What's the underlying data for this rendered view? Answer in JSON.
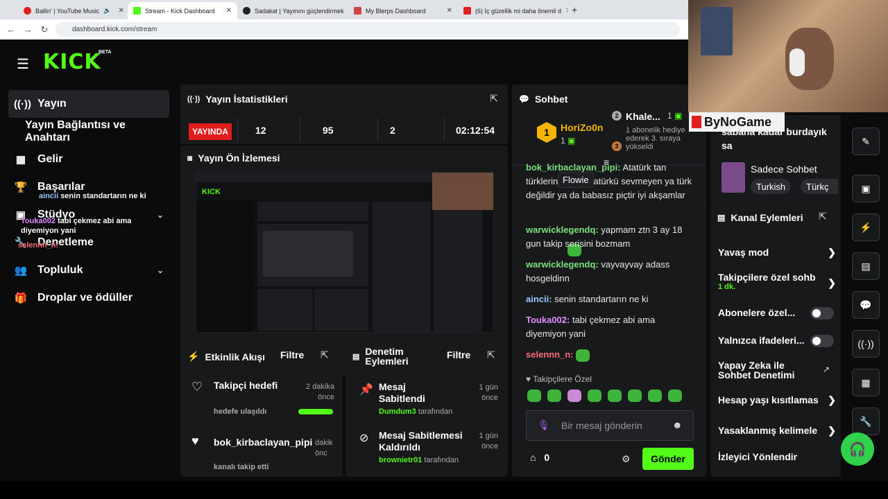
{
  "browser": {
    "tabs": [
      {
        "title": "Ballin' | YouTube Music",
        "color": "#e02020",
        "active": false
      },
      {
        "title": "Stream - Kick Dashboard",
        "color": "#53fc18",
        "active": true
      },
      {
        "title": "Sadakat | Yayınını güçlendirmek",
        "color": "#222",
        "active": false
      },
      {
        "title": "My Blerps Dashboard",
        "color": "#b44",
        "active": false
      },
      {
        "title": "(6) İç güzellik mi daha önemli d",
        "color": "#e02020",
        "active": false
      }
    ],
    "url": "dashboard.kick.com/stream"
  },
  "header": {
    "logo": "KICK",
    "beta": "BETA"
  },
  "sidebar": {
    "items": [
      {
        "label": "Yayın",
        "icon": "broadcast-icon"
      },
      {
        "label": "Yayın Bağlantısı ve Anahtarı",
        "icon": ""
      },
      {
        "label": "Gelir",
        "icon": "chart-icon"
      },
      {
        "label": "Başarılar",
        "icon": "trophy-icon"
      },
      {
        "label": "Stüdyo",
        "icon": "studio-icon"
      },
      {
        "label": "Denetleme",
        "icon": "wrench-icon"
      },
      {
        "label": "Topluluk",
        "icon": "people-icon"
      },
      {
        "label": "Droplar ve ödüller",
        "icon": "drops-icon"
      }
    ],
    "overlay_chat": [
      {
        "user": "aincii",
        "text": "senin standartarın ne ki"
      },
      {
        "user": "Touka002",
        "text": "tabi çekmez abi ama diyemiyon yani"
      },
      {
        "user": "selennn_n:",
        "text": ""
      }
    ]
  },
  "stats": {
    "title": "Yayın İstatistikleri",
    "live_label": "YAYINDA",
    "values": [
      "12",
      "95",
      "2",
      "02:12:54"
    ]
  },
  "preview": {
    "title": "Yayın Ön İzlemesi"
  },
  "activity": {
    "title": "Etkinlik Akışı",
    "filter": "Filtre",
    "items": [
      {
        "title": "Takipçi hedefi",
        "time": "2 dakika önce",
        "sub": "hedefe ulaşıldı"
      },
      {
        "title": "bok_kirbaclayan_pipi",
        "time": "dakik önc",
        "sub": "kanalı takip etti"
      }
    ]
  },
  "moderation": {
    "title": "Denetim Eylemleri",
    "filter": "Filtre",
    "items": [
      {
        "title": "Mesaj Sabitlendi",
        "time": "1 gün önce",
        "user": "Dumdum3",
        "suffix": "tarafından"
      },
      {
        "title": "Mesaj Sabitlemesi Kaldırıldı",
        "time": "1 gün önce",
        "user": "brownietr01",
        "suffix": "tarafından"
      }
    ]
  },
  "chat": {
    "title": "Sohbet",
    "top": [
      {
        "rank": "1",
        "name": "HoriZo0n",
        "count": "1"
      },
      {
        "rank": "2",
        "name": "Khale...",
        "count": "1"
      }
    ],
    "gift_text": "1 abonelik hediye ederek 3. sıraya yükseldi",
    "tooltip": "Flowie",
    "pinned_user": "bok_kirbaclayan_pipi:",
    "pinned_text": "Atatürk tan türklerin ..... ır, Atatürkü sevmeyen ya türk değildir ya da babasız piçtir iyi akşamlar",
    "messages": [
      {
        "user": "warwicklegendq:",
        "color": "#7be07b",
        "text": "yapmam ztn 3 ay 18 gun takip serisini bozmam"
      },
      {
        "user": "warwicklegendq:",
        "color": "#7be07b",
        "text": "vayvayvay adass hosgeldinn"
      },
      {
        "user": "aincii:",
        "color": "#9ac9ff",
        "text": "senin standartarın ne ki"
      },
      {
        "user": "Touka002:",
        "color": "#e28cff",
        "text": "tabi çekmez abi ama diyemiyon yani"
      },
      {
        "user": "selennn_n:",
        "color": "#ff6b7a",
        "text": ""
      }
    ],
    "followers_only": "Takipçilere Özel",
    "input_placeholder": "Bir mesaj gönderin",
    "points": "0",
    "send": "Gönder"
  },
  "channel": {
    "top_text": "sabaha kadar burdayık sa",
    "brand": "ByNoGame",
    "category": "Sadece Sohbet",
    "tags": [
      "Turkish",
      "Türkç"
    ],
    "title": "Kanal Eylemleri",
    "actions": [
      {
        "label": "Yavaş mod",
        "type": "arrow"
      },
      {
        "label": "Takipçilere özel sohb",
        "sub": "1 dk.",
        "type": "arrow"
      },
      {
        "label": "Abonelere özel...",
        "type": "toggle"
      },
      {
        "label": "Yalnızca ifadeleri...",
        "type": "toggle"
      },
      {
        "label": "Yapay Zeka ile Sohbet Denetimi",
        "type": "external"
      },
      {
        "label": "Hesap yaşı kısıtlamas",
        "type": "arrow"
      },
      {
        "label": "Yasaklanmış kelimele",
        "type": "arrow"
      },
      {
        "label": "İzleyici Yönlendir",
        "type": "none"
      }
    ]
  }
}
